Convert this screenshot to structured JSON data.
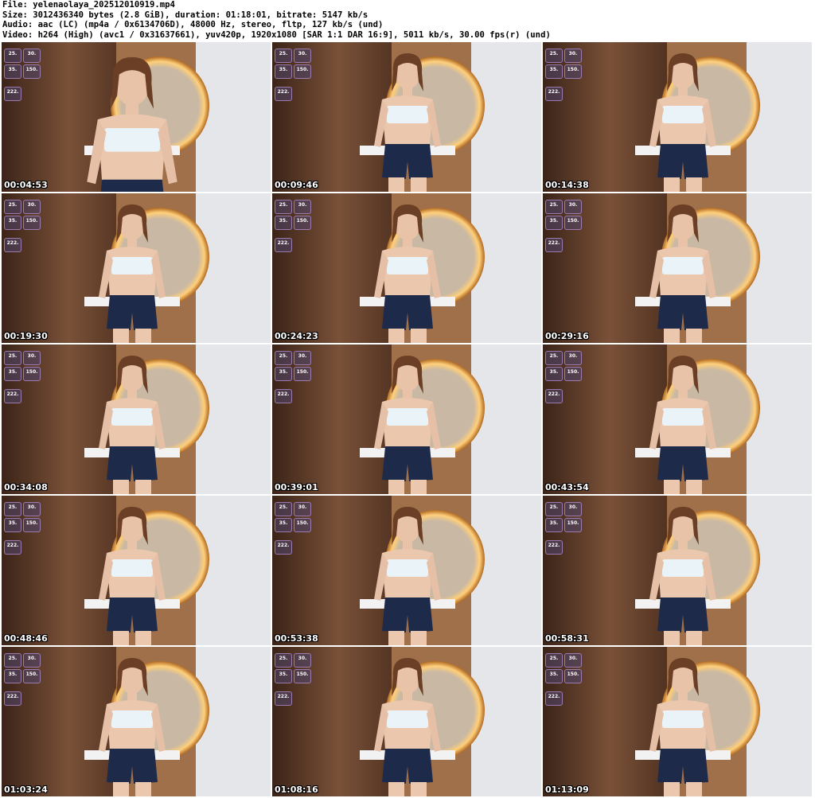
{
  "header": {
    "file": "File: yelenaolaya_202512010919.mp4",
    "size": "Size: 3012436340 bytes (2.8 GiB), duration: 01:18:01, bitrate: 5147 kb/s",
    "audio": "Audio: aac (LC) (mp4a / 0x6134706D), 48000 Hz, stereo, fltp, 127 kb/s (und)",
    "video": "Video: h264 (High) (avc1 / 0x31637661), yuv420p, 1920x1080 [SAR 1:1 DAR 16:9], 5011 kb/s, 30.00 fps(r) (und)"
  },
  "thumbnails": [
    {
      "timestamp": "00:04:53"
    },
    {
      "timestamp": "00:09:46"
    },
    {
      "timestamp": "00:14:38"
    },
    {
      "timestamp": "00:19:30"
    },
    {
      "timestamp": "00:24:23"
    },
    {
      "timestamp": "00:29:16"
    },
    {
      "timestamp": "00:34:08"
    },
    {
      "timestamp": "00:39:01"
    },
    {
      "timestamp": "00:43:54"
    },
    {
      "timestamp": "00:48:46"
    },
    {
      "timestamp": "00:53:38"
    },
    {
      "timestamp": "00:58:31"
    },
    {
      "timestamp": "01:03:24"
    },
    {
      "timestamp": "01:08:16"
    },
    {
      "timestamp": "01:13:09"
    }
  ],
  "overlay_numbers": [
    "25.",
    "30.",
    "35.",
    "150.",
    "222."
  ]
}
